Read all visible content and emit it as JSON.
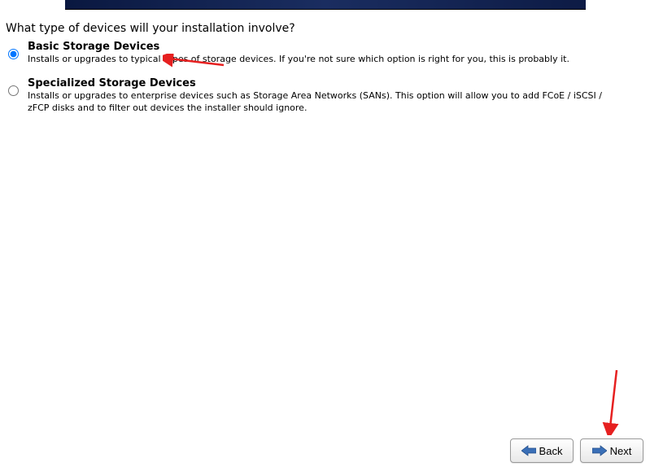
{
  "question": "What type of devices will your installation involve?",
  "options": [
    {
      "title": "Basic Storage Devices",
      "description": "Installs or upgrades to typical types of storage devices.  If you're not sure which option is right for you, this is probably it.",
      "selected": true
    },
    {
      "title": "Specialized Storage Devices",
      "description": "Installs or upgrades to enterprise devices such as Storage Area Networks (SANs). This option will allow you to add FCoE / iSCSI / zFCP disks and to filter out devices the installer should ignore.",
      "selected": false
    }
  ],
  "buttons": {
    "back": "Back",
    "next": "Next"
  }
}
